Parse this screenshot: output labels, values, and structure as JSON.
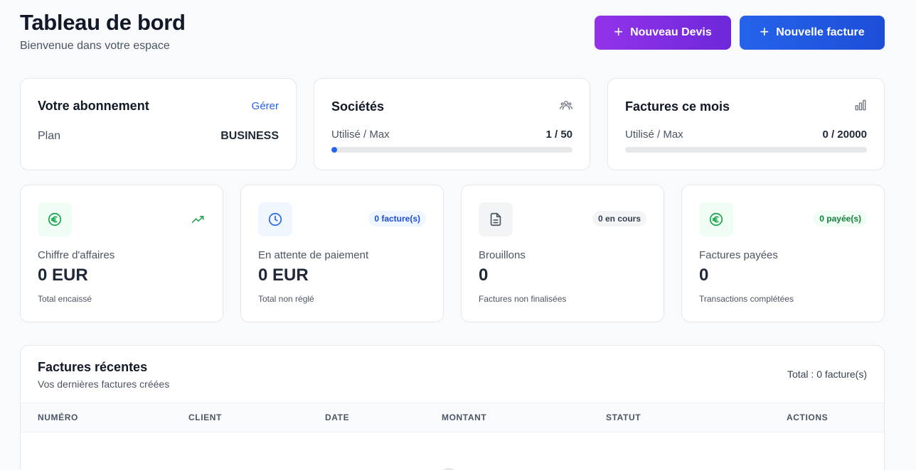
{
  "header": {
    "title": "Tableau de bord",
    "subtitle": "Bienvenue dans votre espace",
    "btn_devis": "Nouveau Devis",
    "btn_facture": "Nouvelle facture"
  },
  "subscription": {
    "title": "Votre abonnement",
    "manage": "Gérer",
    "plan_label": "Plan",
    "plan_value": "BUSINESS"
  },
  "companies": {
    "title": "Sociétés",
    "usage_label": "Utilisé / Max",
    "usage_value": "1 / 50",
    "usage_fraction": 0.02
  },
  "invoices_month": {
    "title": "Factures ce mois",
    "usage_label": "Utilisé / Max",
    "usage_value": "0 / 20000",
    "usage_fraction": 0
  },
  "stats": [
    {
      "label": "Chiffre d'affaires",
      "value": "0 EUR",
      "note": "Total encaissé",
      "badge": ""
    },
    {
      "label": "En attente de paiement",
      "value": "0 EUR",
      "note": "Total non réglé",
      "badge": "0 facture(s)"
    },
    {
      "label": "Brouillons",
      "value": "0",
      "note": "Factures non finalisées",
      "badge": "0 en cours"
    },
    {
      "label": "Factures payées",
      "value": "0",
      "note": "Transactions complétées",
      "badge": "0 payée(s)"
    }
  ],
  "recent": {
    "title": "Factures récentes",
    "subtitle": "Vos dernières factures créées",
    "total": "Total : 0 facture(s)",
    "columns": [
      "NUMÉRO",
      "CLIENT",
      "DATE",
      "MONTANT",
      "STATUT",
      "ACTIONS"
    ]
  },
  "colors": {
    "accent_blue": "#2563eb",
    "accent_purple": "#9333ea",
    "success_green": "#16a34a"
  },
  "icons": {
    "companies": "users-icon",
    "invoices_month": "bar-chart-icon",
    "revenue": "euro-icon",
    "pending": "clock-icon",
    "drafts": "file-text-icon",
    "paid": "euro-icon",
    "trend": "trending-up-icon"
  }
}
